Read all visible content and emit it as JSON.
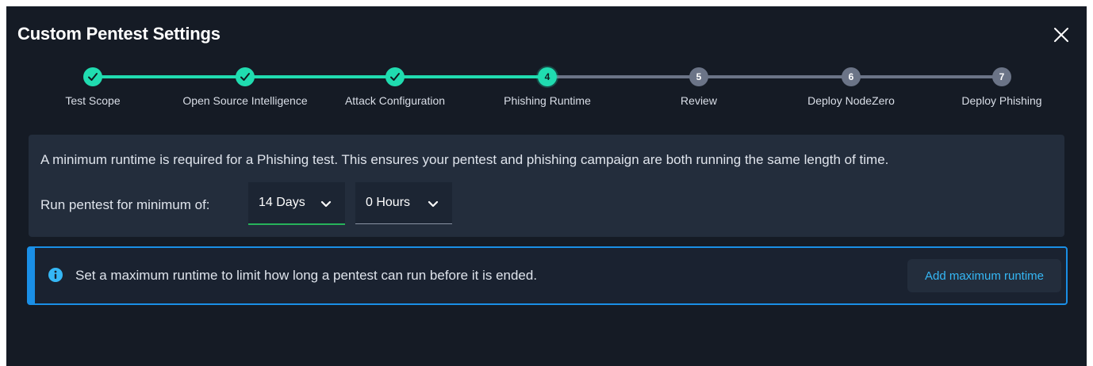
{
  "modal": {
    "title": "Custom Pentest Settings"
  },
  "stepper": {
    "steps": [
      {
        "label": "Test Scope",
        "number": "1",
        "status": "done"
      },
      {
        "label": "Open Source Intelligence",
        "number": "2",
        "status": "done"
      },
      {
        "label": "Attack Configuration",
        "number": "3",
        "status": "done"
      },
      {
        "label": "Phishing Runtime",
        "number": "4",
        "status": "current"
      },
      {
        "label": "Review",
        "number": "5",
        "status": "todo"
      },
      {
        "label": "Deploy NodeZero",
        "number": "6",
        "status": "todo"
      },
      {
        "label": "Deploy Phishing",
        "number": "7",
        "status": "todo"
      }
    ]
  },
  "runtime": {
    "info": "A minimum runtime is required for a Phishing test. This ensures your pentest and phishing campaign are both running the same length of time.",
    "run_label": "Run pentest for minimum of:",
    "days_value": "14 Days",
    "hours_value": "0 Hours"
  },
  "alert": {
    "text": "Set a maximum runtime to limit how long a pentest can run before it is ended.",
    "button_label": "Add maximum runtime"
  },
  "colors": {
    "accent": "#20dcb0",
    "pending": "#6b7487",
    "info_blue": "#1a8fe6",
    "link": "#35b7f5",
    "selected_underline": "#27b35a"
  },
  "icons": {
    "close": "close-icon",
    "check": "check-icon",
    "chevron": "chevron-down-icon",
    "info": "info-icon"
  }
}
